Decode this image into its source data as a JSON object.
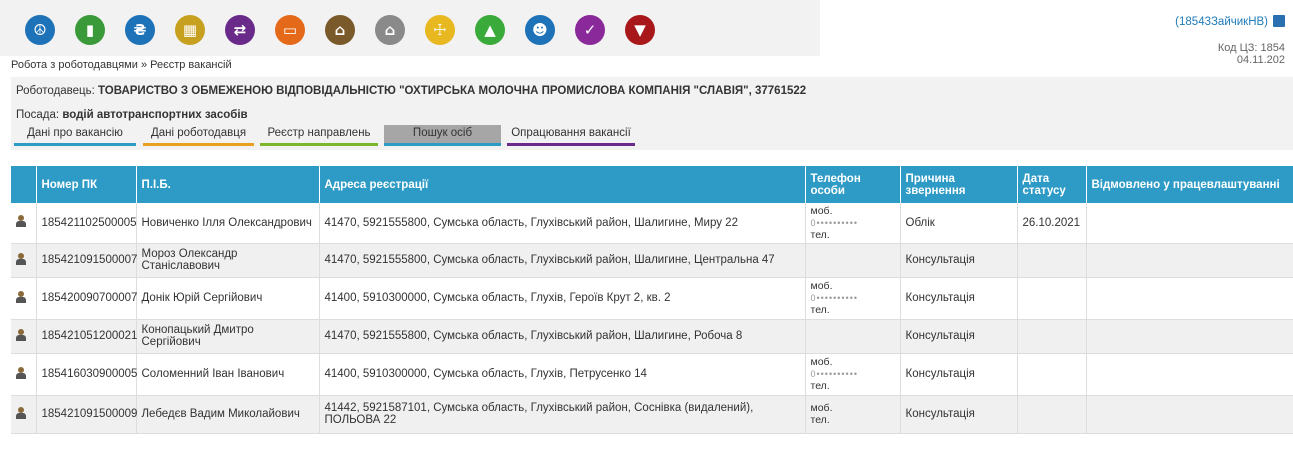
{
  "toolbar": {
    "icons": [
      {
        "name": "employment-service-icon",
        "color": "#1e72b8",
        "glyph": "☮"
      },
      {
        "name": "book-icon",
        "color": "#3a9a3a",
        "glyph": "▮"
      },
      {
        "name": "currency-icon",
        "color": "#1e72b8",
        "glyph": "₴"
      },
      {
        "name": "calculator-icon",
        "color": "#c8a020",
        "glyph": "▦"
      },
      {
        "name": "exchange-icon",
        "color": "#6a2a8a",
        "glyph": "⇄"
      },
      {
        "name": "id-card-icon",
        "color": "#e46a1a",
        "glyph": "▭"
      },
      {
        "name": "house-upgrade-icon",
        "color": "#7a5a2a",
        "glyph": "⌂"
      },
      {
        "name": "home-icon",
        "color": "#8a8a8a",
        "glyph": "⌂"
      },
      {
        "name": "signpost-icon",
        "color": "#e8b820",
        "glyph": "☩"
      },
      {
        "name": "graduation-cap-icon",
        "color": "#3aaa3a",
        "glyph": "▲"
      },
      {
        "name": "user-icon",
        "color": "#1e72b8",
        "glyph": "☻"
      },
      {
        "name": "edit-checklist-icon",
        "color": "#8a2a9a",
        "glyph": "✓"
      },
      {
        "name": "filter-icon",
        "color": "#a8181a",
        "glyph": "▼"
      }
    ]
  },
  "user": {
    "login": "(18543ЗайчикНВ)"
  },
  "kod": {
    "label": "Код ЦЗ: 1854",
    "date": "04.11.202"
  },
  "breadcrumb": {
    "parent": "Робота з роботодавцями",
    "separator": " » ",
    "current": "Реєстр вакансій"
  },
  "employer": {
    "label": "Роботодавець:",
    "name": "ТОВАРИСТВО З ОБМЕЖЕНОЮ ВІДПОВІДАЛЬНІСТЮ \"ОХТИРСЬКА МОЛОЧНА ПРОМИСЛОВА КОМПАНІЯ \"СЛАВІЯ\", 37761522"
  },
  "position": {
    "label": "Посада:",
    "value": "водій автотранспортних засобів"
  },
  "tabs": [
    {
      "label": "Дані про вакансію",
      "color": "#2e9bc6",
      "active": false
    },
    {
      "label": "Дані роботодавця",
      "color": "#e8a020",
      "active": false
    },
    {
      "label": "Реєстр направлень",
      "color": "#7ab82a",
      "active": false
    },
    {
      "label": "Пошук осіб",
      "color": "#2e9bc6",
      "active": true
    },
    {
      "label": "Опрацювання вакансії",
      "color": "#6a2a8a",
      "active": false
    }
  ],
  "table": {
    "headers": [
      "",
      "Номер ПК",
      "П.І.Б.",
      "Адреса реєстрації",
      "Телефон особи",
      "Причина звернення",
      "Дата статусу",
      "Відмовлено у працевлаштуванні"
    ],
    "rows": [
      {
        "pk": "185421102500005",
        "name": "Новиченко Ілля Олександрович",
        "address": "41470, 5921555800, Сумська область, Глухівський район, Шалигине, Миру 22",
        "phone_mob": "моб.",
        "phone_masked": "0••••••••••",
        "phone_tel": "тел.",
        "reason": "Облік",
        "date": "26.10.2021",
        "refused": ""
      },
      {
        "pk": "185421091500007",
        "name": "Мороз Олександр Станіславович",
        "address": "41470, 5921555800, Сумська область, Глухівський район, Шалигине, Центральна 47",
        "phone_mob": "",
        "phone_masked": "",
        "phone_tel": "",
        "reason": "Консультація",
        "date": "",
        "refused": ""
      },
      {
        "pk": "185420090700007",
        "name": "Донік Юрій Сергійович",
        "address": "41400, 5910300000, Сумська область, Глухів, Героїв Крут 2, кв. 2",
        "phone_mob": "моб.",
        "phone_masked": "0••••••••••",
        "phone_tel": "тел.",
        "reason": "Консультація",
        "date": "",
        "refused": ""
      },
      {
        "pk": "185421051200021",
        "name": "Конопацький Дмитро Сергійович",
        "address": "41470, 5921555800, Сумська область, Глухівський район, Шалигине, Робоча 8",
        "phone_mob": "",
        "phone_masked": "",
        "phone_tel": "",
        "reason": "Консультація",
        "date": "",
        "refused": ""
      },
      {
        "pk": "185416030900005",
        "name": "Соломенний Іван Іванович",
        "address": "41400, 5910300000, Сумська область, Глухів, Петрусенко 14",
        "phone_mob": "моб.",
        "phone_masked": "0••••••••••",
        "phone_tel": "тел.",
        "reason": "Консультація",
        "date": "",
        "refused": ""
      },
      {
        "pk": "185421091500009",
        "name": "Лебедєв Вадим Миколайович",
        "address": "41442, 5921587101, Сумська область, Глухівський район, Соснівка (видалений), ПОЛЬОВА 22",
        "phone_mob": "моб.",
        "phone_masked": "",
        "phone_tel": "тел.",
        "reason": "Консультація",
        "date": "",
        "refused": ""
      }
    ]
  }
}
